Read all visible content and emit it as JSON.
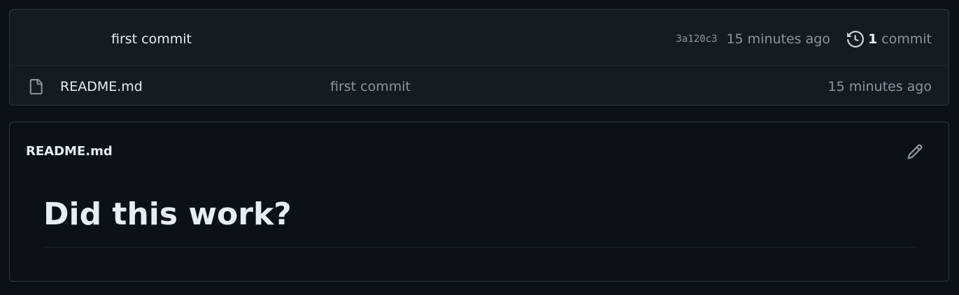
{
  "latest_commit": {
    "message": "first commit",
    "sha": "3a120c3",
    "time": "15 minutes ago",
    "history_count": "1",
    "history_label": "commit"
  },
  "files": [
    {
      "name": "README.md",
      "commit_message": "first commit",
      "time": "15 minutes ago",
      "icon": "file-icon"
    }
  ],
  "readme": {
    "title": "README.md",
    "heading": "Did this work?",
    "edit_icon": "pencil-icon"
  },
  "colors": {
    "background": "#0d1117",
    "panel": "#161b22",
    "border": "#30363d",
    "text": "#e6edf3",
    "muted": "#8b949e"
  }
}
